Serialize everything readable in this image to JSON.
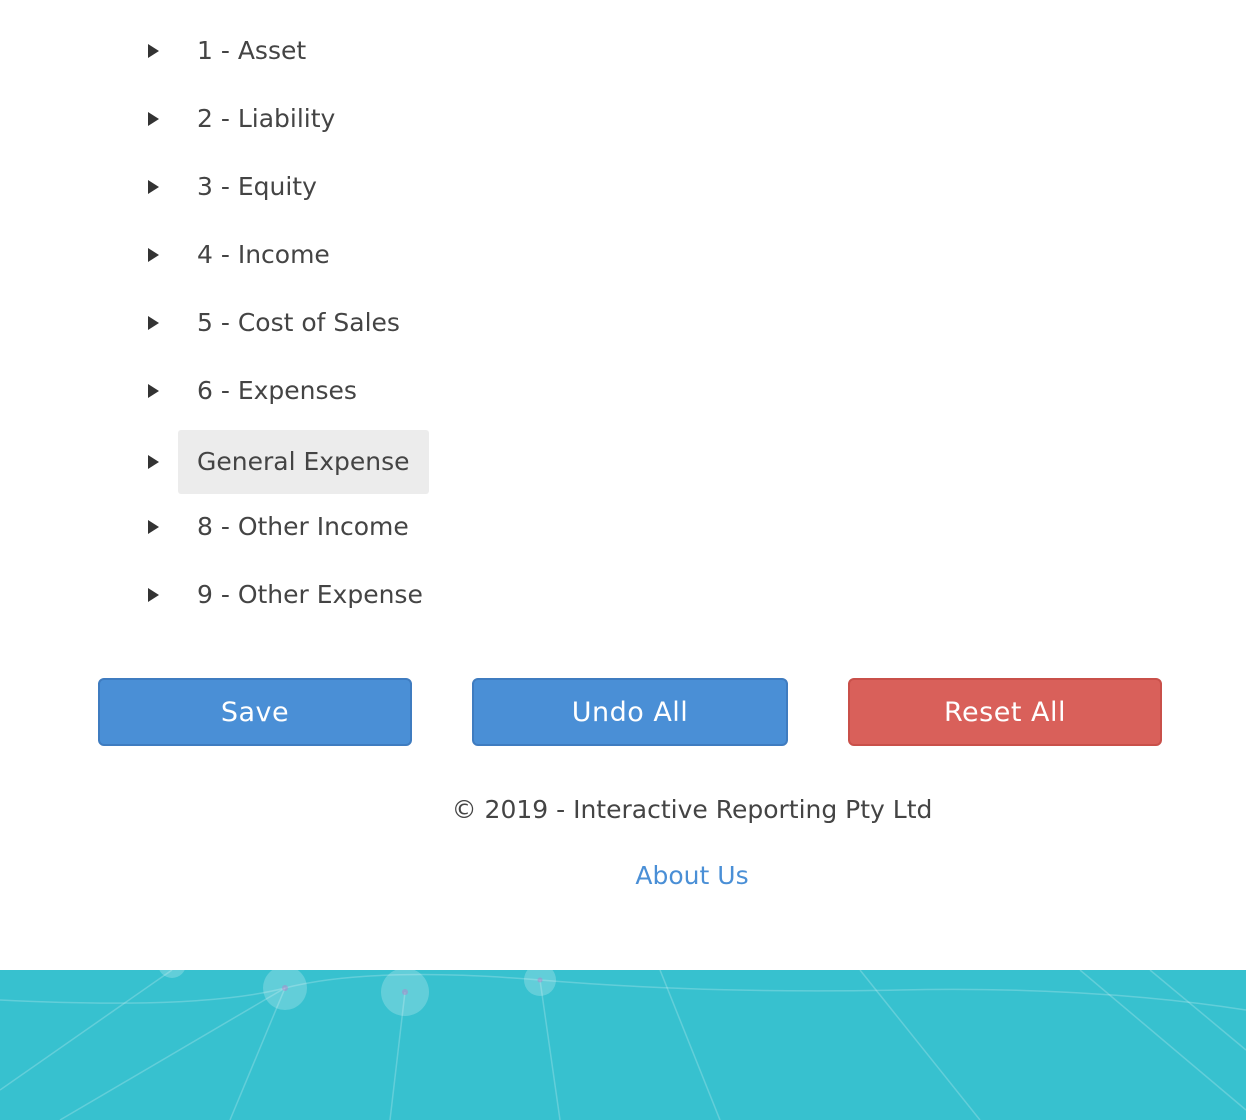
{
  "tree": {
    "nodes": [
      {
        "label": "1 - Asset",
        "selected": false
      },
      {
        "label": "2 - Liability",
        "selected": false
      },
      {
        "label": "3 - Equity",
        "selected": false
      },
      {
        "label": "4 - Income",
        "selected": false
      },
      {
        "label": "5 - Cost of Sales",
        "selected": false
      },
      {
        "label": "6 - Expenses",
        "selected": false
      },
      {
        "label": "General Expense",
        "selected": true
      },
      {
        "label": "8 - Other Income",
        "selected": false
      },
      {
        "label": "9 - Other Expense",
        "selected": false
      }
    ]
  },
  "actions": {
    "save_label": "Save",
    "undo_label": "Undo All",
    "reset_label": "Reset All"
  },
  "footer": {
    "copyright": "© 2019 - Interactive Reporting Pty Ltd",
    "about_link": "About Us"
  },
  "colors": {
    "primary": "#4a8fd6",
    "danger": "#d9605a",
    "band": "#37c1cf",
    "selected_bg": "#ececec"
  },
  "icons": {
    "expand": "caret-right-icon"
  }
}
